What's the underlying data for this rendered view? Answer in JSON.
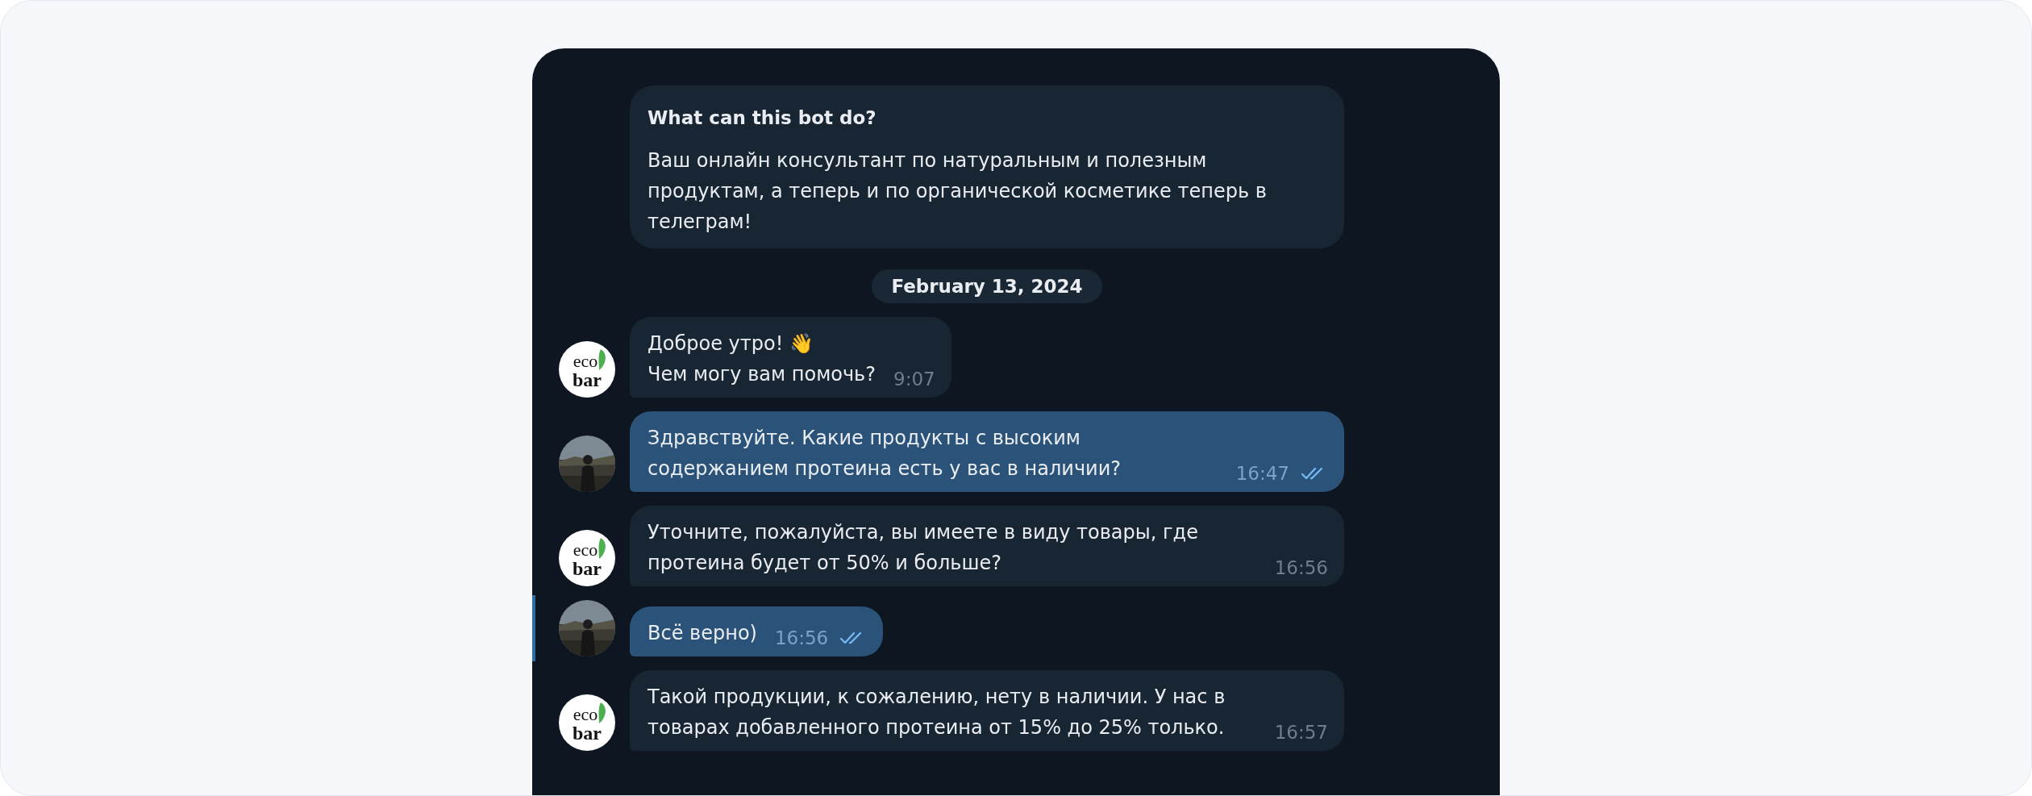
{
  "intro": {
    "title": "What can this bot do?",
    "text": "Ваш онлайн консультант по натуральным и полезным продуктам, а теперь и по органической косметике теперь в телеграм!"
  },
  "date": "February 13, 2024",
  "messages": [
    {
      "kind": "bot",
      "logo": [
        "eco",
        "bar"
      ],
      "text": "Доброе утро! 👋\nЧем могу вам помочь?",
      "time": "9:07",
      "read": false,
      "highlighted": false
    },
    {
      "kind": "user",
      "text": "Здравствуйте. Какие продукты с высоким содержанием протеина есть у вас в наличии?",
      "time": "16:47",
      "read": true,
      "highlighted": false
    },
    {
      "kind": "bot",
      "logo": [
        "eco",
        "bar"
      ],
      "text": "Уточните, пожалуйста, вы имеете в виду товары, где протеина будет от 50% и больше?",
      "time": "16:56",
      "read": false,
      "highlighted": false
    },
    {
      "kind": "user",
      "text": "Всё верно)",
      "time": "16:56",
      "read": true,
      "highlighted": true
    },
    {
      "kind": "bot",
      "logo": [
        "eco",
        "bar"
      ],
      "text": "Такой продукции, к сожалению, нету в наличии. У нас в товарах добавленного протеина от 15% до 25% только.",
      "time": "16:57",
      "read": false,
      "highlighted": false
    }
  ]
}
